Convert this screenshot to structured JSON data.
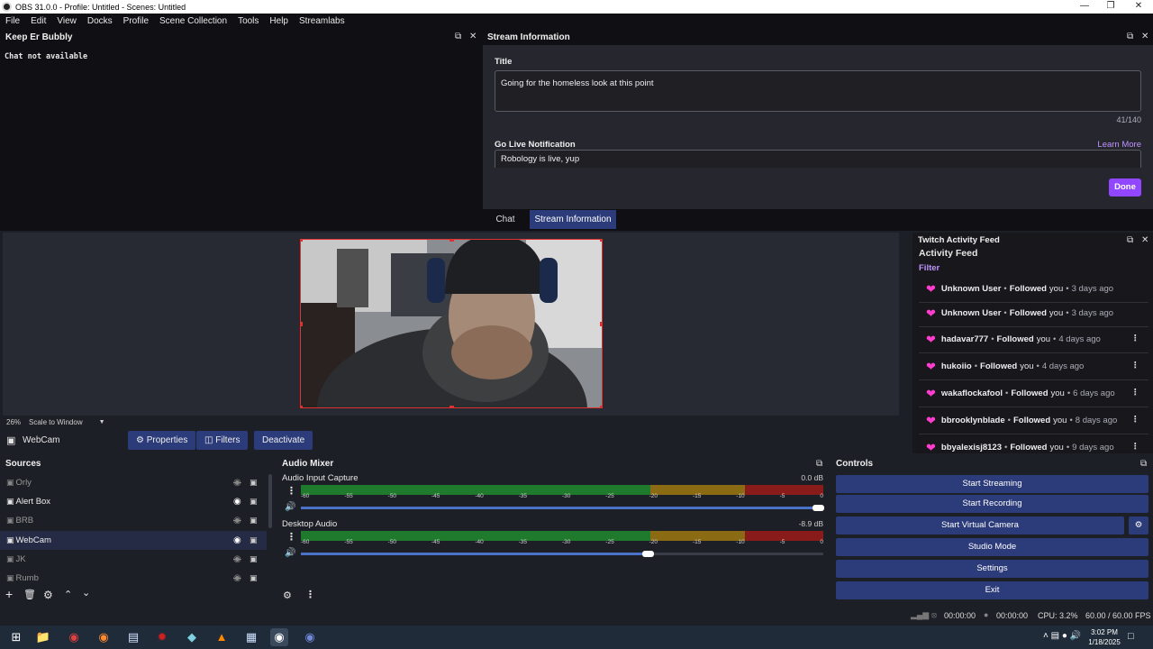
{
  "window": {
    "title": "OBS 31.0.0 - Profile: Untitled - Scenes: Untitled"
  },
  "menu": [
    "File",
    "Edit",
    "View",
    "Docks",
    "Profile",
    "Scene Collection",
    "Tools",
    "Help",
    "Streamlabs"
  ],
  "chat_dock": {
    "title": "Keep Er Bubbly",
    "message": "Chat not available"
  },
  "stream_info": {
    "title": "Stream Information",
    "title_label": "Title",
    "title_value": "Going for the homeless look at this point",
    "char_count": "41/140",
    "notif_label": "Go Live Notification",
    "learn_more": "Learn More",
    "notif_value": "Robology is live, yup",
    "done": "Done",
    "tabs": [
      "Chat",
      "Stream Information"
    ]
  },
  "preview": {
    "zoom": "26%",
    "scale_mode": "Scale to Window"
  },
  "source_bar": {
    "selected": "WebCam",
    "properties": "Properties",
    "filters": "Filters",
    "deactivate": "Deactivate"
  },
  "activity": {
    "dock_title": "Twitch Activity Feed",
    "heading": "Activity Feed",
    "filter": "Filter",
    "items": [
      {
        "user": "Unknown User",
        "event": "Followed",
        "suffix": "you",
        "time": "3 days ago"
      },
      {
        "user": "Unknown User",
        "event": "Followed",
        "suffix": "you",
        "time": "3 days ago"
      },
      {
        "user": "hadavar777",
        "event": "Followed",
        "suffix": "you",
        "time": "4 days ago"
      },
      {
        "user": "hukoiio",
        "event": "Followed",
        "suffix": "you",
        "time": "4 days ago"
      },
      {
        "user": "wakaflockafool",
        "event": "Followed",
        "suffix": "you",
        "time": "6 days ago"
      },
      {
        "user": "bbrooklynblade",
        "event": "Followed",
        "suffix": "you",
        "time": "8 days ago"
      },
      {
        "user": "bbyalexisj8123",
        "event": "Followed",
        "suffix": "you",
        "time": "9 days ago"
      }
    ]
  },
  "sources": {
    "title": "Sources",
    "items": [
      "Orly",
      "Alert Box",
      "BRB",
      "WebCam",
      "JK",
      "Rumb"
    ]
  },
  "mixer": {
    "title": "Audio Mixer",
    "channels": [
      {
        "name": "Audio Input Capture",
        "db": "0.0 dB",
        "level": 1.0
      },
      {
        "name": "Desktop Audio",
        "db": "-8.9 dB",
        "level": 0.67
      }
    ],
    "scale": [
      "-60",
      "-55",
      "-50",
      "-45",
      "-40",
      "-35",
      "-30",
      "-25",
      "-20",
      "-15",
      "-10",
      "-5",
      "0"
    ]
  },
  "controls": {
    "title": "Controls",
    "buttons": [
      "Start Streaming",
      "Start Recording",
      "Start Virtual Camera",
      "Studio Mode",
      "Settings",
      "Exit"
    ]
  },
  "status": {
    "stream_time": "00:00:00",
    "rec_time": "00:00:00",
    "cpu": "CPU: 3.2%",
    "fps": "60.00 / 60.00 FPS"
  },
  "taskbar": {
    "time": "3:02 PM",
    "date": "1/18/2025"
  },
  "colors": {
    "accent": "#9147ff",
    "button": "#2c3b7a",
    "heart": "#ff3dcf",
    "selection": "#e03030"
  }
}
